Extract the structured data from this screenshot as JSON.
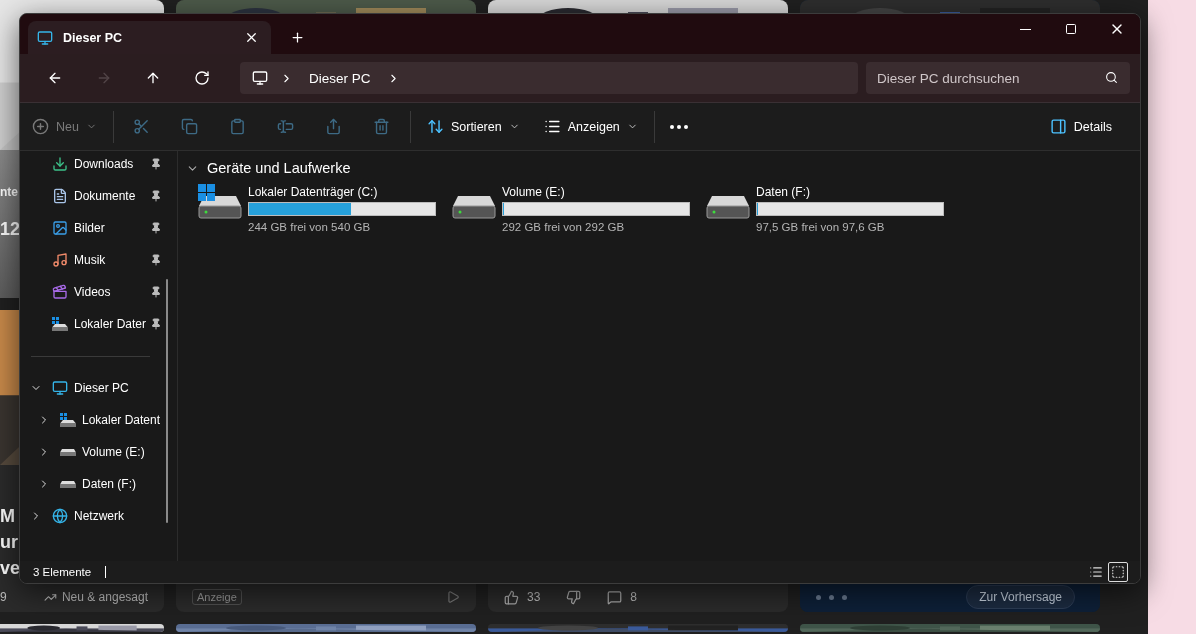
{
  "feed": {
    "top_texts": [
      "nte",
      "12"
    ],
    "story_lines": [
      "M",
      "ur",
      "ve"
    ],
    "footers": [
      {
        "kind": "trend",
        "count": "9",
        "label": "Neu & angesagt"
      },
      {
        "kind": "ad",
        "tag": "Anzeige"
      },
      {
        "kind": "reactions",
        "likes": "33",
        "comments": "8"
      },
      {
        "kind": "weather",
        "button": "Zur Vorhersage"
      }
    ]
  },
  "window": {
    "tabs": [
      {
        "title": "Dieser PC",
        "selected": true
      }
    ],
    "nav": [
      {
        "kind": "back",
        "disabled": false
      },
      {
        "kind": "forward",
        "disabled": true
      },
      {
        "kind": "up",
        "disabled": false
      },
      {
        "kind": "refresh",
        "disabled": false
      }
    ],
    "breadcrumb": [
      "Dieser PC"
    ],
    "search": {
      "placeholder": "Dieser PC durchsuchen"
    },
    "toolbar": [
      {
        "kind": "new",
        "label": "Neu",
        "disabled": true
      },
      {
        "kind": "separator"
      },
      {
        "kind": "cut",
        "disabled": true
      },
      {
        "kind": "copy",
        "disabled": true
      },
      {
        "kind": "paste",
        "disabled": true
      },
      {
        "kind": "rename",
        "disabled": true
      },
      {
        "kind": "share",
        "disabled": true
      },
      {
        "kind": "delete",
        "disabled": true
      },
      {
        "kind": "separator"
      },
      {
        "kind": "sort",
        "label": "Sortieren",
        "disabled": false
      },
      {
        "kind": "view",
        "label": "Anzeigen",
        "disabled": false
      },
      {
        "kind": "separator"
      },
      {
        "kind": "more",
        "disabled": false
      }
    ],
    "details": "Details",
    "sidebar": {
      "quick": [
        {
          "kind": "downloads",
          "label": "Downloads",
          "pinned": true
        },
        {
          "kind": "documents",
          "label": "Dokumente",
          "pinned": true
        },
        {
          "kind": "pictures",
          "label": "Bilder",
          "pinned": true
        },
        {
          "kind": "music",
          "label": "Musik",
          "pinned": true
        },
        {
          "kind": "videos",
          "label": "Videos",
          "pinned": true
        },
        {
          "kind": "system-drive",
          "label": "Lokaler Dater",
          "pinned": true
        }
      ],
      "tree": [
        {
          "kind": "pc",
          "label": "Dieser PC",
          "expanded": true,
          "children": [
            {
              "kind": "system-drive",
              "label": "Lokaler Datent",
              "expanded": false
            },
            {
              "kind": "drive",
              "label": "Volume (E:)",
              "expanded": false
            },
            {
              "kind": "drive",
              "label": "Daten (F:)",
              "expanded": false
            }
          ]
        },
        {
          "kind": "network",
          "label": "Netzwerk",
          "expanded": false
        }
      ]
    },
    "section": {
      "title": "Geräte und Laufwerke",
      "expanded": true
    },
    "drives": [
      {
        "kind": "system",
        "name": "Lokaler Datenträger (C:)",
        "level": 0.55,
        "space": "244 GB frei von 540 GB"
      },
      {
        "kind": "data",
        "name": "Volume (E:)",
        "level": 0,
        "space": "292 GB frei von 292 GB"
      },
      {
        "kind": "data",
        "name": "Daten (F:)",
        "level": 0,
        "space": "97,5 GB frei von 97,6 GB"
      }
    ],
    "status": "3 Elemente",
    "view_modes": [
      {
        "kind": "details",
        "selected": false
      },
      {
        "kind": "tiles",
        "selected": true
      }
    ]
  }
}
